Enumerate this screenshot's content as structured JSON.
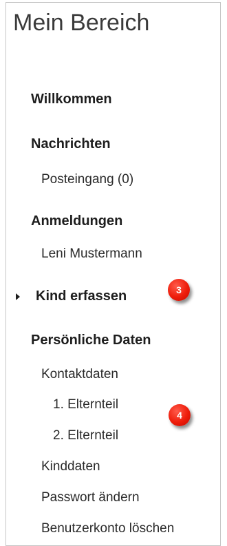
{
  "panel": {
    "title": "Mein Bereich"
  },
  "menu": {
    "willkommen": "Willkommen",
    "nachrichten": "Nachrichten",
    "posteingang": "Posteingang (0)",
    "anmeldungen": "Anmeldungen",
    "leni": "Leni Mustermann",
    "kind_erfassen": "Kind erfassen",
    "persoenliche_daten": "Persönliche Daten",
    "kontaktdaten": "Kontaktdaten",
    "elternteil_1": "1. Elternteil",
    "elternteil_2": "2. Elternteil",
    "kinddaten": "Kinddaten",
    "passwort": "Passwort ändern",
    "benutzerkonto": "Benutzerkonto löschen"
  },
  "badges": {
    "first": "3",
    "second": "4"
  },
  "icons": {
    "expand": "caret-right-icon"
  },
  "colors": {
    "badge": "#ee1c0a"
  }
}
